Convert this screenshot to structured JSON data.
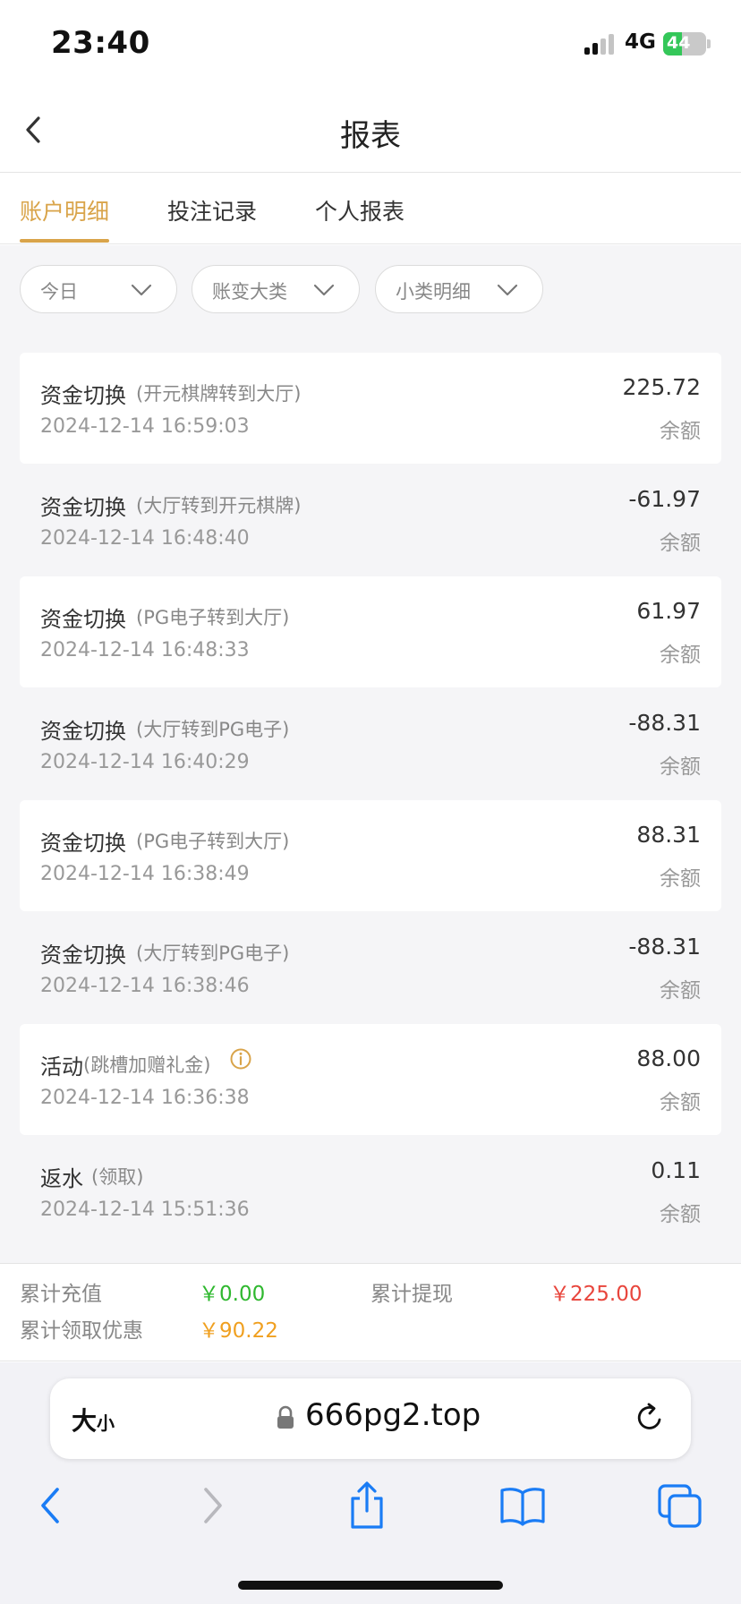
{
  "status_bar": {
    "time": "23:40",
    "network": "4G",
    "battery": "44",
    "battery_level": 0.44,
    "battery_color": "#34c759"
  },
  "nav": {
    "title": "报表",
    "back_icon": "chevron-left-icon"
  },
  "tabs": [
    {
      "label": "账户明细",
      "active": true
    },
    {
      "label": "投注记录",
      "active": false
    },
    {
      "label": "个人报表",
      "active": false
    }
  ],
  "accent_color": "#d9a44a",
  "filters": [
    {
      "label": "今日",
      "icon": "chevron-down-icon"
    },
    {
      "label": "账变大类",
      "icon": "chevron-down-icon"
    },
    {
      "label": "小类明细",
      "icon": "chevron-down-icon"
    }
  ],
  "records": [
    {
      "title": "资金切换",
      "detail": "(开元棋牌转到大厅)",
      "time": "2024-12-14 16:59:03",
      "amount": "225.72",
      "balance_label": "余额"
    },
    {
      "title": "资金切换",
      "detail": "(大厅转到开元棋牌)",
      "time": "2024-12-14 16:48:40",
      "amount": "-61.97",
      "balance_label": "余额"
    },
    {
      "title": "资金切换",
      "detail": "(PG电子转到大厅)",
      "time": "2024-12-14 16:48:33",
      "amount": "61.97",
      "balance_label": "余额"
    },
    {
      "title": "资金切换",
      "detail": "(大厅转到PG电子)",
      "time": "2024-12-14 16:40:29",
      "amount": "-88.31",
      "balance_label": "余额"
    },
    {
      "title": "资金切换",
      "detail": "(PG电子转到大厅)",
      "time": "2024-12-14 16:38:49",
      "amount": "88.31",
      "balance_label": "余额"
    },
    {
      "title": "资金切换",
      "detail": "(大厅转到PG电子)",
      "time": "2024-12-14 16:38:46",
      "amount": "-88.31",
      "balance_label": "余额"
    },
    {
      "title": "活动",
      "detail": "(跳槽加赠礼金)",
      "time": "2024-12-14 16:36:38",
      "amount": "88.00",
      "balance_label": "余额",
      "info_icon": "info-circle-icon"
    },
    {
      "title": "返水",
      "detail": "(领取)",
      "time": "2024-12-14 15:51:36",
      "amount": "0.11",
      "balance_label": "余额"
    }
  ],
  "summary": {
    "total_deposit_label": "累计充值",
    "total_deposit_value": "￥0.00",
    "total_deposit_color": "#2fb82f",
    "total_withdraw_label": "累计提现",
    "total_withdraw_value": "￥225.00",
    "total_withdraw_color": "#e8453c",
    "total_bonus_label": "累计领取优惠",
    "total_bonus_value": "￥90.22",
    "total_bonus_color": "#f0a020"
  },
  "browser": {
    "text_size_big": "大",
    "text_size_small": "小",
    "url": "666pg2.top",
    "icons": [
      "lock-icon",
      "reload-icon",
      "back-arrow-icon",
      "forward-arrow-icon",
      "share-icon",
      "bookmarks-icon",
      "tabs-icon"
    ]
  }
}
